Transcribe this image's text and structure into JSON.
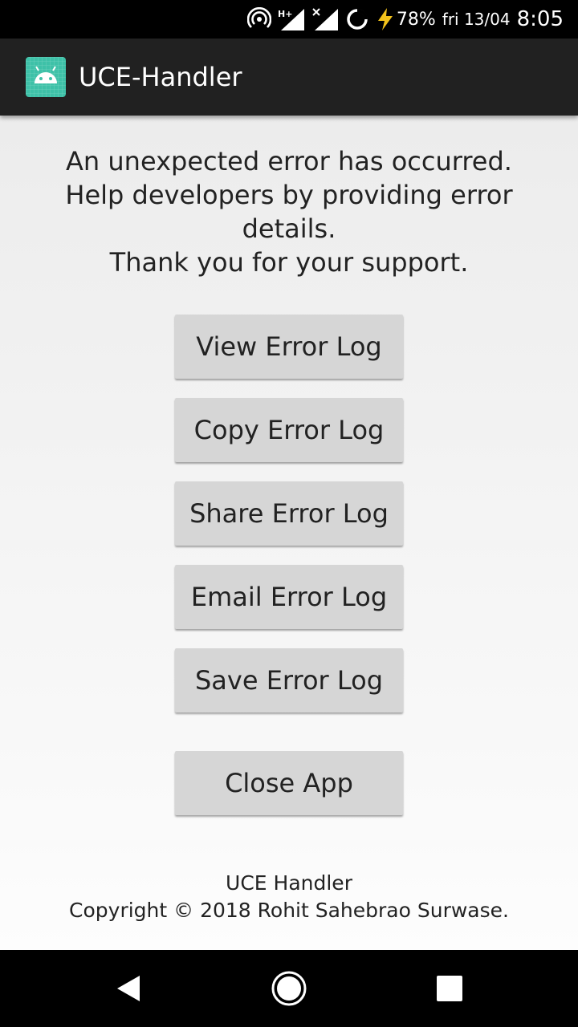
{
  "status_bar": {
    "battery": "78%",
    "date": "fri 13/04",
    "time": "8:05",
    "icons": [
      "hotspot-icon",
      "signal-hplus-icon",
      "signal-x-icon",
      "sync-ring-icon",
      "charging-bolt-icon"
    ]
  },
  "app_bar": {
    "title": "UCE-Handler",
    "icon": "android-app-icon",
    "accent": "#3ec1a8"
  },
  "message": {
    "lines": [
      "An unexpected error has occurred.",
      "Help developers by providing error",
      "details.",
      "Thank you for your support."
    ]
  },
  "buttons": {
    "view": "View Error Log",
    "copy": "Copy Error Log",
    "share": "Share Error Log",
    "email": "Email Error Log",
    "save": "Save Error Log",
    "close": "Close App"
  },
  "footer": {
    "line1": "UCE Handler",
    "line2": "Copyright © 2018 Rohit Sahebrao Surwase."
  },
  "nav_bar": {
    "icons": [
      "back-icon",
      "home-icon",
      "recents-icon"
    ]
  }
}
